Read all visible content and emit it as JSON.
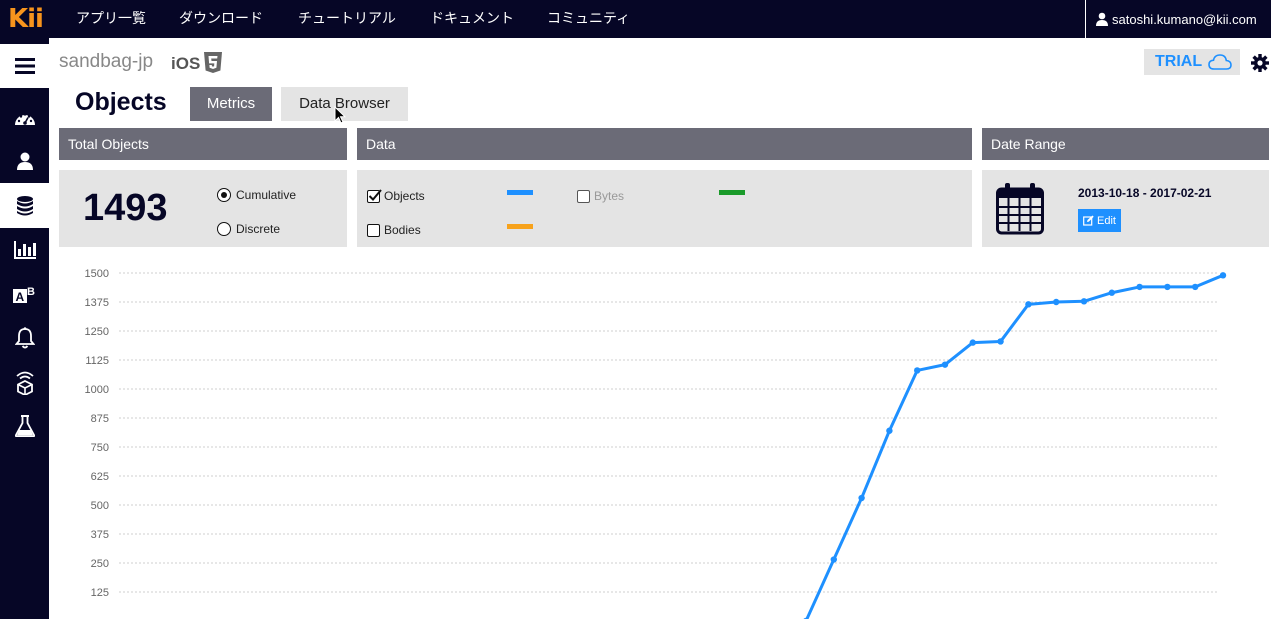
{
  "nav": {
    "logo": "Kii",
    "links": [
      "アプリ一覧",
      "ダウンロード",
      "チュートリアル",
      "ドキュメント",
      "コミュニティ"
    ],
    "user_email": "satoshi.kumano@kii.com"
  },
  "sidebar": {
    "items": [
      {
        "icon": "menu-icon"
      },
      {
        "icon": "dashboard-icon"
      },
      {
        "icon": "user-icon"
      },
      {
        "icon": "database-icon",
        "active": true
      },
      {
        "icon": "analytics-icon"
      },
      {
        "icon": "ab-test-icon"
      },
      {
        "icon": "bell-icon"
      },
      {
        "icon": "iot-cube-icon"
      },
      {
        "icon": "flask-icon"
      }
    ]
  },
  "header": {
    "app_name": "sandbag-jp",
    "platform": "iOS",
    "plan": "TRIAL",
    "page_title": "Objects",
    "tabs": [
      {
        "label": "Metrics",
        "active": true
      },
      {
        "label": "Data Browser",
        "active": false
      }
    ]
  },
  "panels": {
    "total": {
      "title": "Total Objects",
      "value": "1493",
      "options": [
        {
          "label": "Cumulative",
          "selected": true
        },
        {
          "label": "Discrete",
          "selected": false
        }
      ]
    },
    "data": {
      "title": "Data",
      "series": [
        {
          "label": "Objects",
          "checked": true,
          "color": "#1e90ff"
        },
        {
          "label": "Bodies",
          "checked": false,
          "color": "#f7a21b"
        },
        {
          "label": "Bytes",
          "checked": false,
          "color": "#1a9a2a",
          "disabled": true
        }
      ]
    },
    "date_range": {
      "title": "Date Range",
      "value": "2013-10-18 - 2017-02-21",
      "edit_label": "Edit"
    }
  },
  "chart_data": {
    "type": "line",
    "title": "",
    "xlabel": "",
    "ylabel": "",
    "ylim": [
      0,
      1500
    ],
    "yticks": [
      125,
      250,
      375,
      500,
      625,
      750,
      875,
      1000,
      1125,
      1250,
      1375,
      1500
    ],
    "grid": true,
    "series": [
      {
        "color": "#1e90ff",
        "values": [
          0,
          265,
          530,
          820,
          1080,
          1105,
          1200,
          1205,
          1365,
          1375,
          1378,
          1415,
          1440,
          1440,
          1440,
          1490
        ]
      }
    ]
  }
}
